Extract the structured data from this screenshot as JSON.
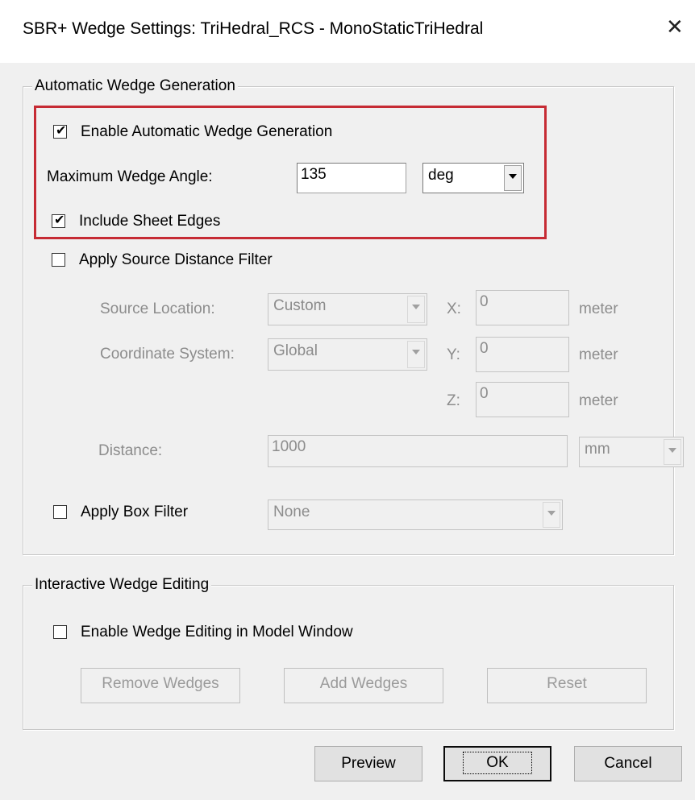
{
  "window": {
    "title": "SBR+ Wedge Settings: TriHedral_RCS - MonoStaticTriHedral",
    "close_label": "✕"
  },
  "auto_wedge": {
    "legend": "Automatic Wedge Generation",
    "enable_label": "Enable Automatic Wedge Generation",
    "enable_checked": true,
    "max_angle_label": "Maximum Wedge Angle:",
    "max_angle_value": "135",
    "max_angle_unit": "deg",
    "include_sheet_label": "Include Sheet Edges",
    "include_sheet_checked": true,
    "source_filter_label": "Apply Source Distance Filter",
    "source_filter_checked": false,
    "source_location_label": "Source Location:",
    "source_location_value": "Custom",
    "coord_system_label": "Coordinate System:",
    "coord_system_value": "Global",
    "x_label": "X:",
    "x_value": "0",
    "x_unit": "meter",
    "y_label": "Y:",
    "y_value": "0",
    "y_unit": "meter",
    "z_label": "Z:",
    "z_value": "0",
    "z_unit": "meter",
    "distance_label": "Distance:",
    "distance_value": "1000",
    "distance_unit": "mm",
    "box_filter_label": "Apply Box Filter",
    "box_filter_checked": false,
    "box_filter_value": "None"
  },
  "interactive": {
    "legend": "Interactive Wedge Editing",
    "enable_label": "Enable Wedge Editing in Model Window",
    "enable_checked": false,
    "remove_label": "Remove Wedges",
    "add_label": "Add Wedges",
    "reset_label": "Reset"
  },
  "footer": {
    "preview_label": "Preview",
    "ok_label": "OK",
    "cancel_label": "Cancel"
  },
  "highlight_color": "#c62b34"
}
